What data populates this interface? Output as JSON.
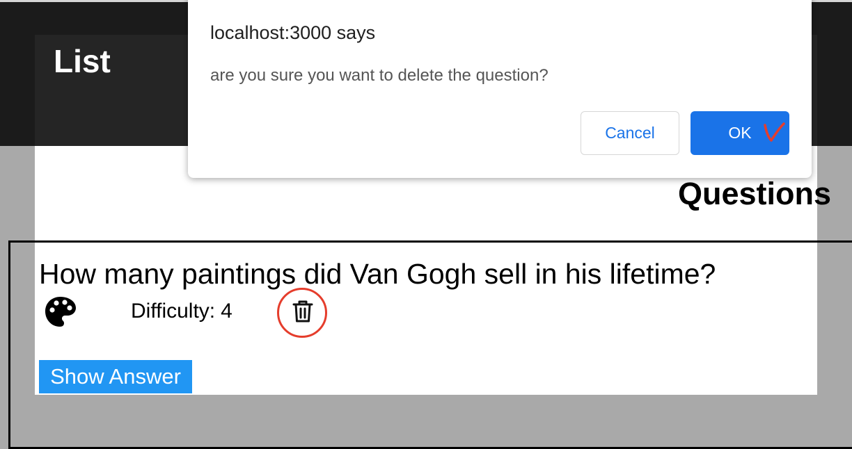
{
  "header": {
    "title": "List"
  },
  "section": {
    "title": "Questions"
  },
  "question": {
    "text": "How many paintings did Van Gogh sell in his lifetime?",
    "category_icon": "palette-icon",
    "difficulty_label": "Difficulty:",
    "difficulty_value": "4",
    "delete_icon": "trash-icon",
    "show_answer_label": "Show Answer"
  },
  "dialog": {
    "origin": "localhost:3000 says",
    "message": "are you sure you want to delete the question?",
    "cancel_label": "Cancel",
    "ok_label": "OK"
  },
  "colors": {
    "page_background": "#a9a9a9",
    "header_background": "#1b1b1b",
    "accent_blue": "#2196f3",
    "dialog_ok": "#1a73e8",
    "annotation_red": "#e53d2c"
  }
}
